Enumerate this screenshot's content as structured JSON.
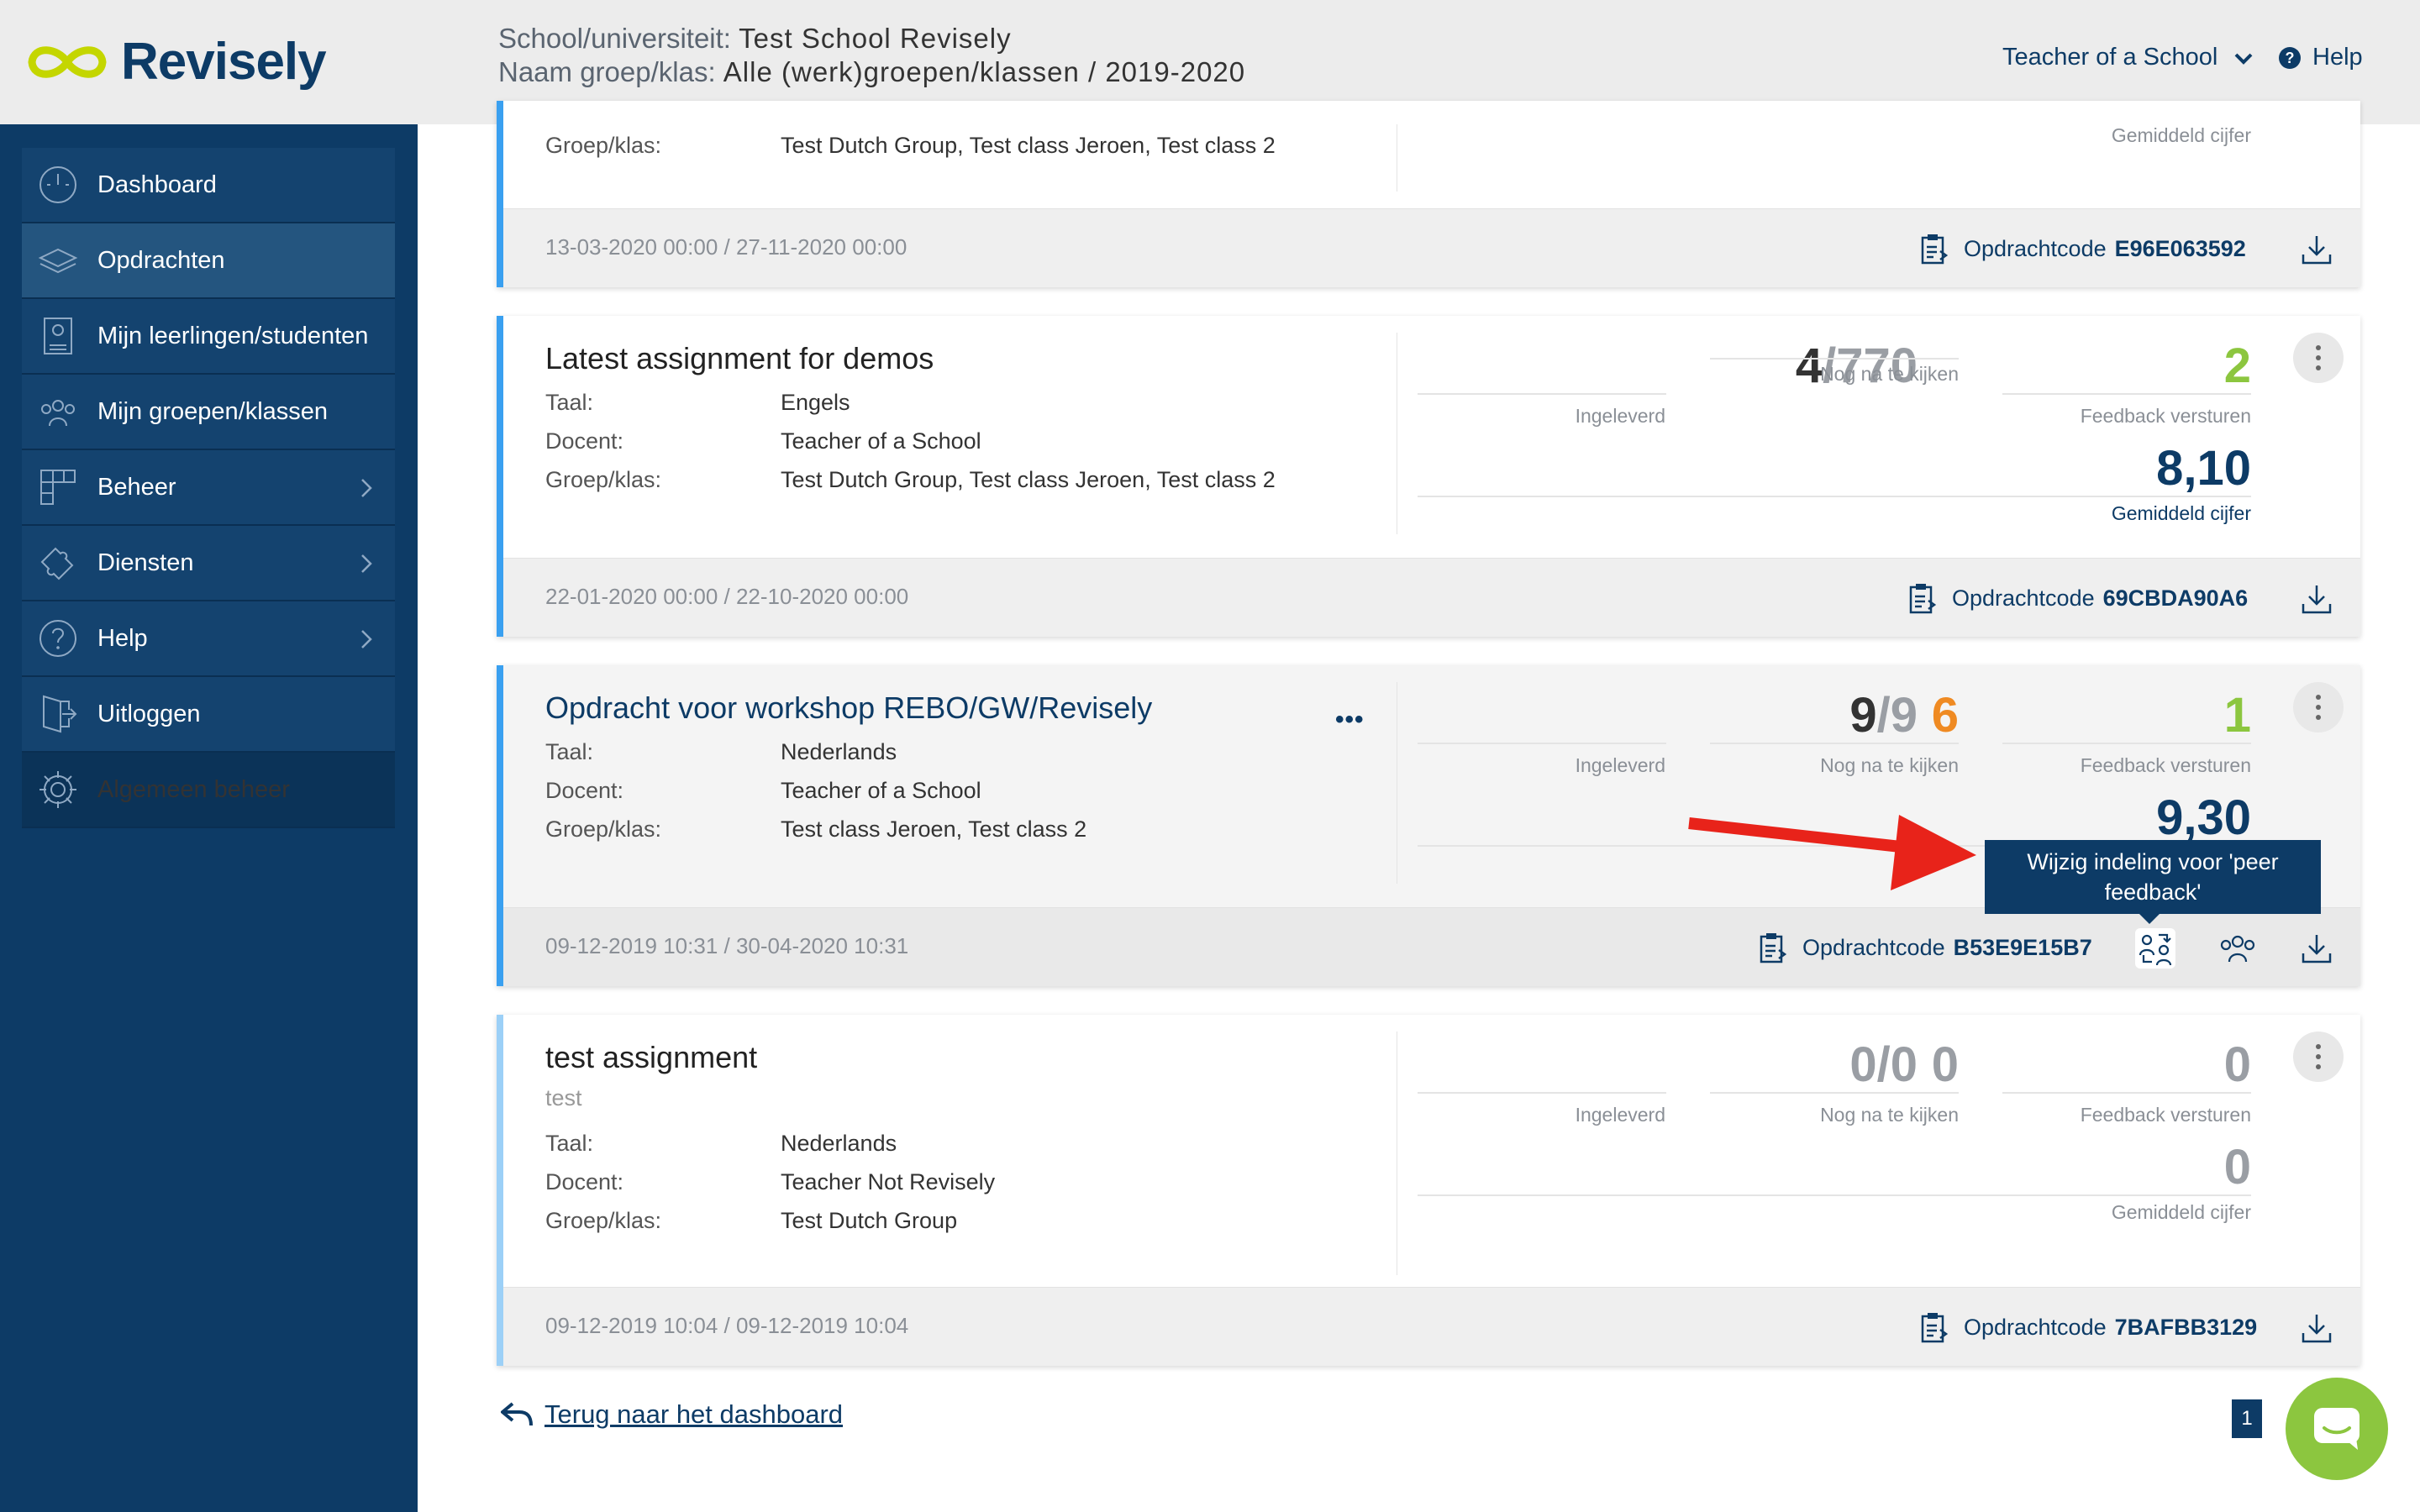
{
  "brand": {
    "name": "Revisely",
    "colors": {
      "navy": "#0d3b66",
      "green": "#8cc63f",
      "orange": "#ef8a22",
      "blue": "#3aa0f0",
      "red": "#e8231a"
    }
  },
  "header": {
    "school_label": "School/universiteit:",
    "school_value": "Test School Revisely",
    "group_label": "Naam groep/klas:",
    "group_value": "Alle (werk)groepen/klassen / 2019-2020",
    "user_menu": "Teacher of a School",
    "help": "Help"
  },
  "sidebar": {
    "items": [
      {
        "label": "Dashboard",
        "icon": "dashboard-icon"
      },
      {
        "label": "Opdrachten",
        "icon": "assignments-icon"
      },
      {
        "label": "Mijn leerlingen/studenten",
        "icon": "students-icon"
      },
      {
        "label": "Mijn groepen/klassen",
        "icon": "groups-icon"
      },
      {
        "label": "Beheer",
        "icon": "grid-icon"
      },
      {
        "label": "Diensten",
        "icon": "puzzle-icon"
      },
      {
        "label": "Help",
        "icon": "help-icon"
      },
      {
        "label": "Uitloggen",
        "icon": "logout-icon"
      },
      {
        "label": "Algemeen beheer",
        "icon": "gear-icon"
      }
    ]
  },
  "labels": {
    "taal": "Taal:",
    "docent": "Docent:",
    "groep": "Groep/klas:",
    "ingeleverd": "Ingeleverd",
    "nog": "Nog na te kijken",
    "feedback": "Feedback versturen",
    "gemiddeld": "Gemiddeld cijfer",
    "code": "Opdrachtcode",
    "slash": "/"
  },
  "assignments": [
    {
      "groep": "Test Dutch Group, Test class Jeroen, Test class 2",
      "dates": "13-03-2020 00:00 / 27-11-2020 00:00",
      "code": "E96E063592"
    },
    {
      "title": "Latest assignment for demos",
      "taal": "Engels",
      "docent": "Teacher of a School",
      "groep": "Test Dutch Group, Test class Jeroen, Test class 2",
      "ingeleverd_a": "4",
      "ingeleverd_b": "770",
      "nog": "",
      "feedback": "2",
      "gemiddeld": "8,10",
      "dates": "22-01-2020 00:00 / 22-10-2020 00:00",
      "code": "69CBDA90A6"
    },
    {
      "title": "Opdracht voor workshop REBO/GW/Revisely",
      "more": "•••",
      "taal": "Nederlands",
      "docent": "Teacher of a School",
      "groep": "Test class Jeroen, Test class 2",
      "ingeleverd_a": "9",
      "ingeleverd_b": "9",
      "nog": "6",
      "feedback": "1",
      "gemiddeld": "9,30",
      "dates": "09-12-2019 10:31 / 30-04-2020 10:31",
      "code": "B53E9E15B7"
    },
    {
      "title": "test assignment",
      "subtitle": "test",
      "taal": "Nederlands",
      "docent": "Teacher Not Revisely",
      "groep": "Test Dutch Group",
      "ingeleverd_a": "0",
      "ingeleverd_b": "0",
      "nog": "0",
      "feedback": "0",
      "gemiddeld": "0",
      "dates": "09-12-2019 10:04 / 09-12-2019 10:04",
      "code": "7BAFBB3129"
    }
  ],
  "tooltip": "Wijzig indeling voor 'peer feedback'",
  "footer": {
    "back": "Terug naar het dashboard",
    "page": "1"
  }
}
